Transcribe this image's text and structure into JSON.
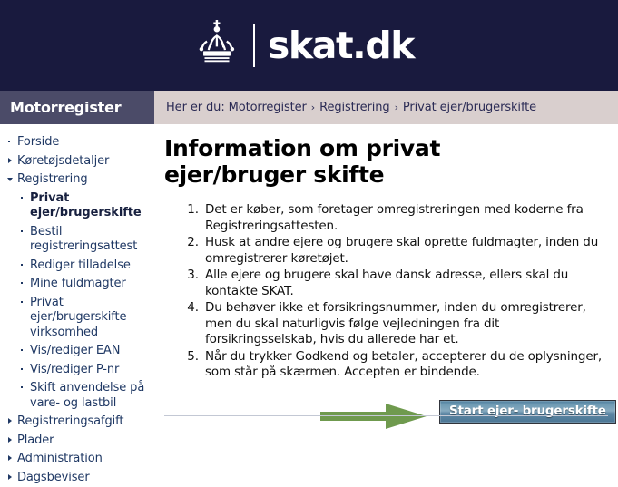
{
  "header": {
    "brand_name": "skat.dk",
    "crown_icon": "danish-crown-icon"
  },
  "breadcrumb": {
    "section_tab": "Motorregister",
    "prefix": "Her er du:",
    "separator": "›",
    "items": [
      "Motorregister",
      "Registrering",
      "Privat ejer/brugerskifte"
    ]
  },
  "sidebar": {
    "items": [
      {
        "label": "Forside",
        "level": 0,
        "marker": "dot",
        "active": false
      },
      {
        "label": "Køretøjsdetaljer",
        "level": 0,
        "marker": "collapsed",
        "active": false
      },
      {
        "label": "Registrering",
        "level": 0,
        "marker": "expanded",
        "active": false
      },
      {
        "label": "Privat ejer/brugerskifte",
        "level": 1,
        "marker": "dot",
        "active": true
      },
      {
        "label": "Bestil registreringsattest",
        "level": 1,
        "marker": "dot",
        "active": false
      },
      {
        "label": "Rediger tilladelse",
        "level": 1,
        "marker": "dot",
        "active": false
      },
      {
        "label": "Mine fuldmagter",
        "level": 1,
        "marker": "dot",
        "active": false
      },
      {
        "label": "Privat ejer/brugerskifte virksomhed",
        "level": 1,
        "marker": "dot",
        "active": false
      },
      {
        "label": "Vis/rediger EAN",
        "level": 1,
        "marker": "dot",
        "active": false
      },
      {
        "label": "Vis/rediger P-nr",
        "level": 1,
        "marker": "dot",
        "active": false
      },
      {
        "label": "Skift anvendelse på vare- og lastbil",
        "level": 1,
        "marker": "dot",
        "active": false
      },
      {
        "label": "Registreringsafgift",
        "level": 0,
        "marker": "collapsed",
        "active": false
      },
      {
        "label": "Plader",
        "level": 0,
        "marker": "collapsed",
        "active": false
      },
      {
        "label": "Administration",
        "level": 0,
        "marker": "collapsed",
        "active": false
      },
      {
        "label": "Dagsbeviser",
        "level": 0,
        "marker": "collapsed",
        "active": false
      }
    ]
  },
  "main": {
    "title": "Information om privat ejer/bruger skifte",
    "steps": [
      "Det er køber, som foretager omregistreringen med koderne fra Registreringsattesten.",
      "Husk at andre ejere og brugere skal oprette fuldmagter, inden du omregistrerer køretøjet.",
      "Alle ejere og brugere skal have dansk adresse, ellers skal du kontakte SKAT.",
      "Du behøver ikke et forsikringsnummer, inden du omregistrerer, men du skal naturligvis følge vejledningen fra dit forsikringsselskab, hvis du allerede har et.",
      "Når du trykker Godkend og betaler, accepterer du de oplysninger, som står på skærmen. Accepten er bindende."
    ],
    "start_button_label": "Start ejer- brugerskifte",
    "pointer_arrow_icon": "green-right-arrow-icon"
  },
  "colors": {
    "header_navy": "#191A3E",
    "section_tab": "#4b4b68",
    "breadcrumb_bg": "#d9cfce",
    "nav_link": "#1f3864",
    "arrow_green": "#6f9a4e",
    "button_blue": "#6f9bb4"
  }
}
